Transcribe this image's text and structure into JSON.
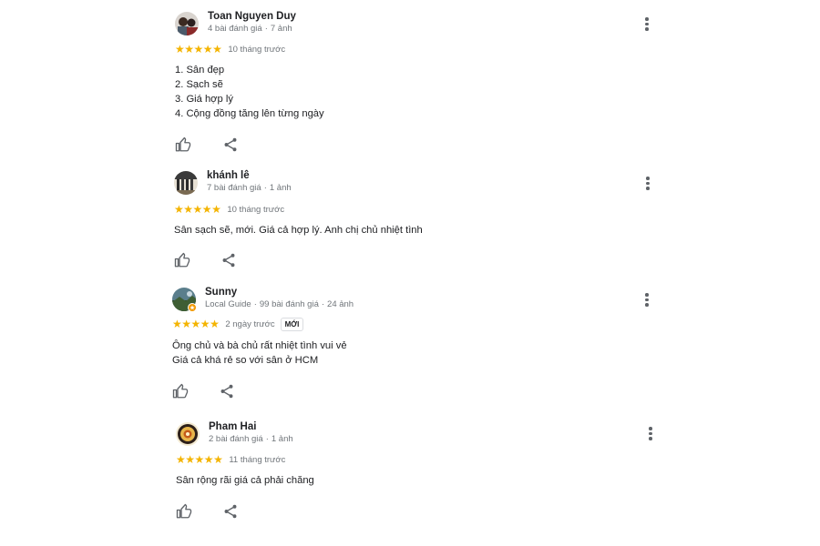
{
  "reviews": [
    {
      "name": "Toan Nguyen Duy",
      "meta_parts": [
        "4 bài đánh giá",
        "7 ảnh"
      ],
      "rating": 5,
      "time": "10 tháng trước",
      "badge": "",
      "lines": [
        "1. Sân đẹp",
        "2. Sạch sẽ",
        "3. Giá hợp lý",
        "4. Cộng đồng tăng lên từng ngày"
      ]
    },
    {
      "name": "khánh lê",
      "meta_parts": [
        "7 bài đánh giá",
        "1 ảnh"
      ],
      "rating": 5,
      "time": "10 tháng trước",
      "badge": "",
      "lines": [
        "Sân sạch sẽ, mới. Giá cả hợp lý. Anh chị chủ nhiệt tình"
      ]
    },
    {
      "name": "Sunny",
      "meta_parts": [
        "Local Guide",
        "99 bài đánh giá",
        "24 ảnh"
      ],
      "rating": 5,
      "time": "2 ngày trước",
      "badge": "MỚI",
      "lines": [
        "Ông chủ và bà chủ rất nhiệt tình vui vẻ",
        "Giá cả khá rẻ so với sân ở HCM"
      ]
    },
    {
      "name": "Pham Hai",
      "meta_parts": [
        "2 bài đánh giá",
        "1 ảnh"
      ],
      "rating": 5,
      "time": "11 tháng trước",
      "badge": "",
      "lines": [
        "Sân rộng rãi giá cả phải chăng"
      ]
    }
  ],
  "icons": {
    "like": "thumb-up-icon",
    "share": "share-icon",
    "more": "more-vertical-icon",
    "star": "star-icon"
  },
  "colors": {
    "star": "#f4b400",
    "meta": "#70757a",
    "text": "#202124",
    "icon": "#5f6368"
  }
}
